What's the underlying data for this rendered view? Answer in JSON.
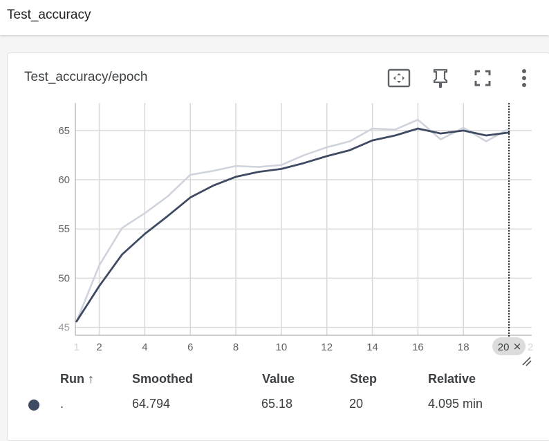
{
  "header": {
    "title": "Test_accuracy"
  },
  "card": {
    "title": "Test_accuracy/epoch",
    "tools": [
      "fit-domain-icon",
      "pin-icon",
      "fullscreen-icon",
      "more-vert-icon"
    ]
  },
  "colors": {
    "smoothed": "#3f4b63",
    "raw": "#cfd3dc",
    "grid": "#d9d9d9",
    "cursor": "#000000"
  },
  "chart_data": {
    "type": "line",
    "title": "Test_accuracy/epoch",
    "xlabel": "",
    "ylabel": "",
    "xlim": [
      0.95,
      21
    ],
    "ylim": [
      44.2,
      67.8
    ],
    "x_ticks": [
      "1",
      "2",
      "4",
      "6",
      "8",
      "10",
      "12",
      "14",
      "16",
      "18",
      "20",
      "2"
    ],
    "y_ticks": [
      "45",
      "50",
      "55",
      "60",
      "65"
    ],
    "x": [
      1,
      2,
      3,
      4,
      5,
      6,
      7,
      8,
      9,
      10,
      11,
      12,
      13,
      14,
      15,
      16,
      17,
      18,
      19,
      20
    ],
    "series": [
      {
        "name": "raw",
        "values": [
          45.6,
          51.3,
          55.1,
          56.6,
          58.3,
          60.5,
          60.9,
          61.4,
          61.3,
          61.5,
          62.5,
          63.3,
          63.9,
          65.2,
          65.1,
          66.1,
          64.1,
          65.3,
          63.9,
          65.18
        ]
      },
      {
        "name": "smoothed",
        "values": [
          45.6,
          49.2,
          52.4,
          54.5,
          56.3,
          58.2,
          59.4,
          60.3,
          60.8,
          61.1,
          61.7,
          62.4,
          63.0,
          64.0,
          64.5,
          65.2,
          64.7,
          65.0,
          64.5,
          64.794
        ]
      }
    ],
    "cursor_step": "20",
    "cursor_close": "×",
    "grid": true
  },
  "table": {
    "headers": [
      "Run ↑",
      "Smoothed",
      "Value",
      "Step",
      "Relative"
    ],
    "row": {
      "run": ".",
      "smoothed": "64.794",
      "value": "65.18",
      "step": "20",
      "relative": "4.095 min"
    }
  }
}
